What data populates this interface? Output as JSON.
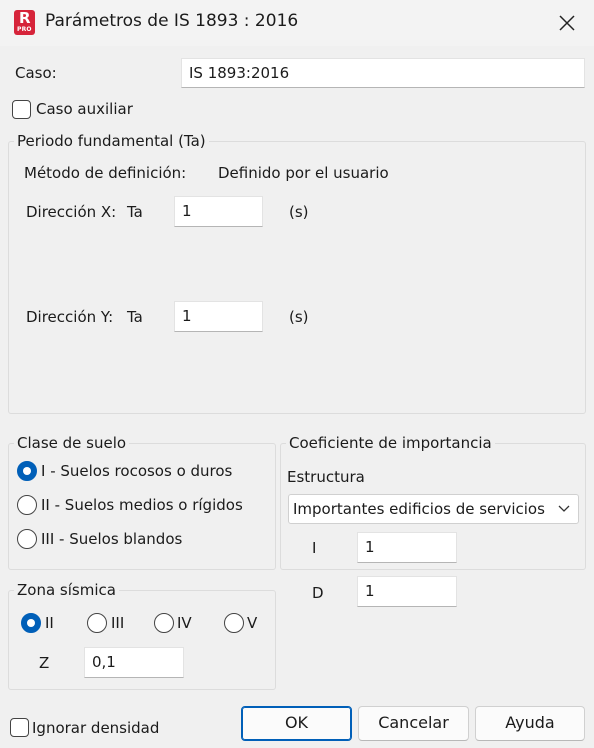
{
  "window": {
    "title": "Parámetros de IS 1893 : 2016",
    "app_icon_letter": "R",
    "app_icon_badge": "PRO",
    "app_icon_color": "#d6243a"
  },
  "case": {
    "label": "Caso:",
    "value": "IS 1893:2016"
  },
  "auxiliary_case": {
    "label": "Caso auxiliar",
    "checked": false
  },
  "fundamental_period": {
    "legend": "Periodo fundamental (Ta)",
    "definition_method_label": "Método de definición:",
    "definition_method_value": "Definido por el usuario",
    "dir_x": {
      "label": "Dirección X:",
      "symbol": "Ta",
      "value": "1",
      "unit": "(s)"
    },
    "dir_y": {
      "label": "Dirección Y:",
      "symbol": "Ta",
      "value": "1",
      "unit": "(s)"
    }
  },
  "soil_class": {
    "legend": "Clase de suelo",
    "options": [
      {
        "label": "I - Suelos rocosos o duros",
        "checked": true
      },
      {
        "label": "II - Suelos medios o rígidos",
        "checked": false
      },
      {
        "label": "III - Suelos blandos",
        "checked": false
      }
    ]
  },
  "importance": {
    "legend": "Coeficiente de importancia",
    "structure_label": "Estructura",
    "structure_value": "Importantes edificios de servicios y",
    "i_label": "I",
    "i_value": "1",
    "d_label": "D",
    "d_value": "1"
  },
  "seismic_zone": {
    "legend": "Zona sísmica",
    "options": [
      {
        "label": "II",
        "checked": true
      },
      {
        "label": "III",
        "checked": false
      },
      {
        "label": "IV",
        "checked": false
      },
      {
        "label": "V",
        "checked": false
      }
    ],
    "z_label": "Z",
    "z_value": "0,1"
  },
  "ignore_density": {
    "label": "Ignorar densidad",
    "checked": false
  },
  "buttons": {
    "ok": "OK",
    "cancel": "Cancelar",
    "help": "Ayuda"
  },
  "colors": {
    "accent": "#005fb8",
    "background": "#f0f0f0"
  }
}
